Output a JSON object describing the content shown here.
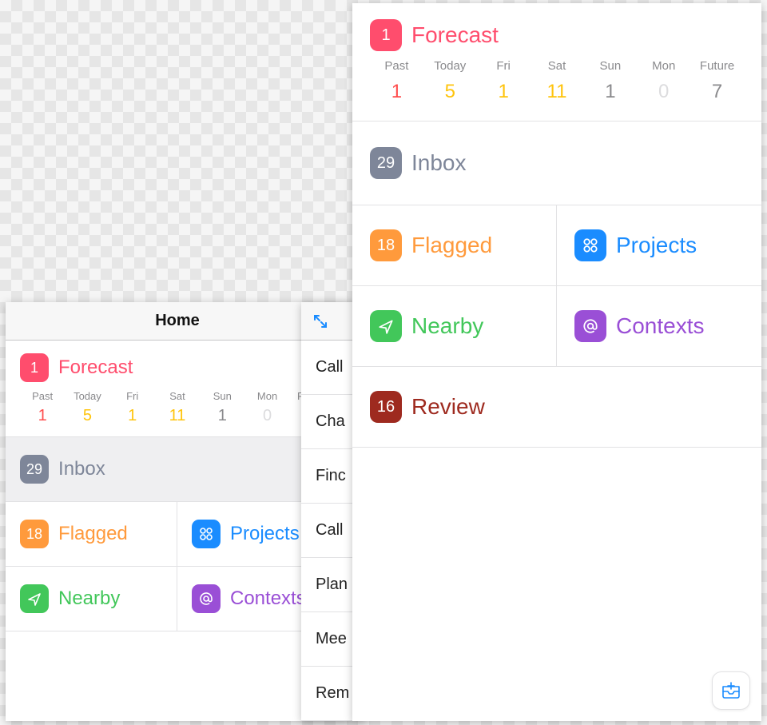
{
  "header": {
    "title": "Home"
  },
  "forecast": {
    "badge": "1",
    "label": "Forecast",
    "days": [
      {
        "name": "Past",
        "value": "1",
        "color": "red"
      },
      {
        "name": "Today",
        "value": "5",
        "color": "yellow"
      },
      {
        "name": "Fri",
        "value": "1",
        "color": "yellow"
      },
      {
        "name": "Sat",
        "value": "11",
        "color": "yellow"
      },
      {
        "name": "Sun",
        "value": "1",
        "color": "gray"
      },
      {
        "name": "Mon",
        "value": "0",
        "color": "faint"
      },
      {
        "name": "Future",
        "value": "7",
        "color": "gray"
      }
    ]
  },
  "inbox": {
    "badge": "29",
    "label": "Inbox"
  },
  "flagged": {
    "badge": "18",
    "label": "Flagged"
  },
  "projects": {
    "label": "Projects"
  },
  "nearby": {
    "label": "Nearby"
  },
  "contexts": {
    "label": "Contexts"
  },
  "review": {
    "badge": "16",
    "label": "Review"
  },
  "tasks": [
    "Call",
    "Cha",
    "Finc",
    "Call",
    "Plan",
    "Mee",
    "Rem"
  ],
  "icons": {
    "projects": "four-circles-icon",
    "nearby": "location-arrow-icon",
    "contexts": "at-sign-icon",
    "expand": "expand-icon",
    "add_inbox": "inbox-plus-icon"
  },
  "colors": {
    "pink": "#ff4d6d",
    "gray": "#7e8699",
    "orange": "#ff9a3c",
    "blue": "#1a8cff",
    "green": "#42c75a",
    "purple": "#9a4fd6",
    "brown": "#9e2a1f"
  }
}
